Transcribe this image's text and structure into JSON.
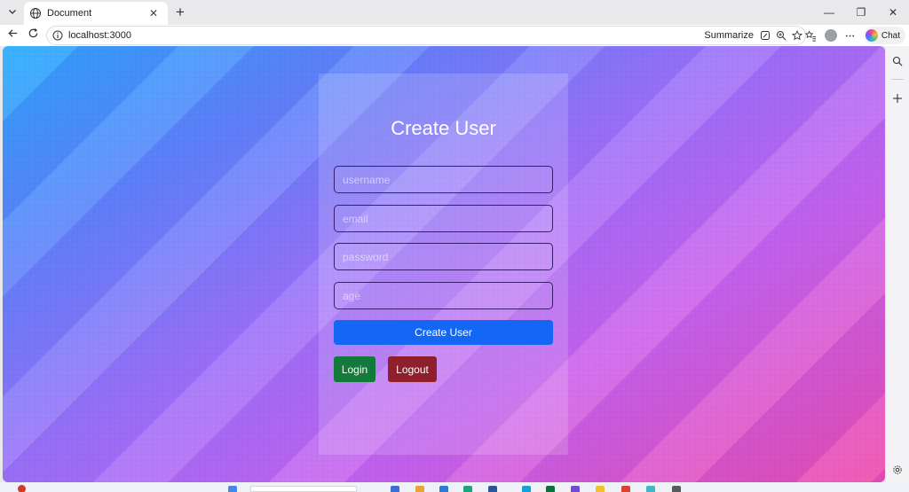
{
  "browser": {
    "tab": {
      "title": "Document"
    },
    "address_url": "localhost:3000",
    "summarize_label": "Summarize",
    "chat_label": "Chat"
  },
  "form": {
    "title": "Create User",
    "fields": {
      "username_placeholder": "username",
      "email_placeholder": "email",
      "password_placeholder": "password",
      "age_placeholder": "age"
    },
    "create_button": "Create User",
    "login_button": "Login",
    "logout_button": "Logout"
  },
  "colors": {
    "create_button": "#1466f5",
    "login_button": "#137a3c",
    "logout_button": "#8e1f2b"
  },
  "icons": {
    "tab_menu": "chevron-down-icon",
    "favicon": "globe-icon",
    "back": "back-arrow-icon",
    "reload": "reload-icon",
    "site_info": "info-icon",
    "zoom": "zoom-icon",
    "favorite": "star-icon",
    "favorites_bar": "favorites-icon",
    "profile": "profile-icon",
    "more": "more-icon",
    "search": "search-icon",
    "add": "plus-icon",
    "settings": "gear-icon"
  }
}
